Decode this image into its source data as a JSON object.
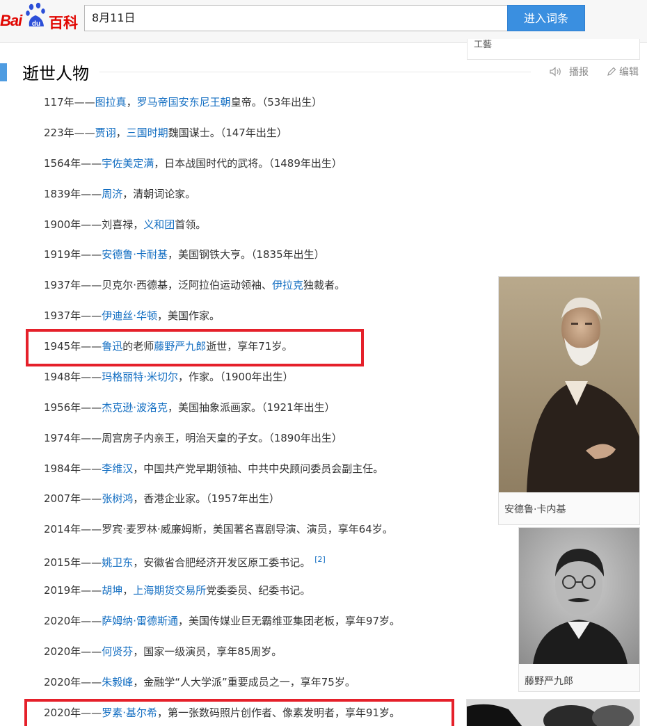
{
  "header": {
    "logo_bai": "Bai",
    "logo_du": "du",
    "logo_baike": "百科",
    "search_value": "8月11日",
    "search_button": "进入词条",
    "cut_text": "工藝"
  },
  "section": {
    "title": "逝世人物",
    "broadcast_label": "播报",
    "edit_label": "编辑"
  },
  "rows": [
    {
      "date": "117年——",
      "parts": [
        [
          "l",
          "图拉真"
        ],
        [
          "t",
          "，"
        ],
        [
          "l",
          "罗马帝国安东尼王朝"
        ],
        [
          "t",
          "皇帝。（53年出生）"
        ]
      ]
    },
    {
      "date": "223年——",
      "parts": [
        [
          "l",
          "贾诩"
        ],
        [
          "t",
          "，"
        ],
        [
          "l",
          "三国时期"
        ],
        [
          "t",
          "魏国谋士。（147年出生）"
        ]
      ]
    },
    {
      "date": "1564年——",
      "parts": [
        [
          "l",
          "宇佐美定满"
        ],
        [
          "t",
          "，日本战国时代的武将。（1489年出生）"
        ]
      ]
    },
    {
      "date": "1839年——",
      "parts": [
        [
          "l",
          "周济"
        ],
        [
          "t",
          "，清朝词论家。"
        ]
      ]
    },
    {
      "date": "1900年——",
      "parts": [
        [
          "t",
          "刘喜禄，"
        ],
        [
          "l",
          "义和团"
        ],
        [
          "t",
          "首领。"
        ]
      ]
    },
    {
      "date": "1919年——",
      "parts": [
        [
          "l",
          "安德鲁·卡耐基"
        ],
        [
          "t",
          "，美国钢铁大亨。（1835年出生）"
        ]
      ]
    },
    {
      "date": "1937年——",
      "parts": [
        [
          "t",
          "贝克尔·西德基，泛阿拉伯运动领袖、"
        ],
        [
          "l",
          "伊拉克"
        ],
        [
          "t",
          "独裁者。"
        ]
      ]
    },
    {
      "date": "1937年——",
      "parts": [
        [
          "l",
          "伊迪丝·华顿"
        ],
        [
          "t",
          "，美国作家。"
        ]
      ]
    },
    {
      "date": "1945年——",
      "parts": [
        [
          "l",
          "鲁迅"
        ],
        [
          "t",
          "的老师"
        ],
        [
          "l",
          "藤野严九郎"
        ],
        [
          "t",
          "逝世，享年71岁。"
        ]
      ]
    },
    {
      "date": "1948年——",
      "parts": [
        [
          "l",
          "玛格丽特·米切尔"
        ],
        [
          "t",
          "，作家。（1900年出生）"
        ]
      ]
    },
    {
      "date": "1956年——",
      "parts": [
        [
          "l",
          "杰克逊·波洛克"
        ],
        [
          "t",
          "，美国抽象派画家。（1921年出生）"
        ]
      ]
    },
    {
      "date": "1974年——",
      "parts": [
        [
          "t",
          "周宫房子内亲王，明治天皇的子女。（1890年出生）"
        ]
      ]
    },
    {
      "date": "1984年——",
      "parts": [
        [
          "l",
          "李维汉"
        ],
        [
          "t",
          "，中国共产党早期领袖、中共中央顾问委员会副主任。"
        ]
      ]
    },
    {
      "date": "2007年——",
      "parts": [
        [
          "l",
          "张树鸿"
        ],
        [
          "t",
          "，香港企业家。（1957年出生）"
        ]
      ]
    },
    {
      "date": "2014年——",
      "parts": [
        [
          "t",
          "罗宾·麦罗林·威廉姆斯，美国著名喜剧导演、演员，享年64岁。"
        ]
      ]
    },
    {
      "date": "2015年——",
      "parts": [
        [
          "l",
          "姚卫东"
        ],
        [
          "t",
          "，安徽省合肥经济开发区原工委书记。"
        ],
        [
          "s",
          "[2]"
        ]
      ]
    },
    {
      "date": "2019年——",
      "parts": [
        [
          "l",
          "胡坤"
        ],
        [
          "t",
          "，"
        ],
        [
          "l",
          "上海期货交易所"
        ],
        [
          "t",
          "党委委员、纪委书记。"
        ]
      ]
    },
    {
      "date": "2020年——",
      "parts": [
        [
          "l",
          "萨姆纳·雷德斯通"
        ],
        [
          "t",
          "，美国传媒业巨无霸维亚集团老板，享年97岁。"
        ]
      ]
    },
    {
      "date": "2020年——",
      "parts": [
        [
          "l",
          "何贤芬"
        ],
        [
          "t",
          "，国家一级演员，享年85周岁。"
        ]
      ]
    },
    {
      "date": "2020年——",
      "parts": [
        [
          "l",
          "朱毅峰"
        ],
        [
          "t",
          "，金融学“人大学派”重要成员之一，享年75岁。"
        ]
      ]
    },
    {
      "date": "2020年——",
      "parts": [
        [
          "l",
          "罗素·基尔希"
        ],
        [
          "t",
          "，第一张数码照片创作者、像素发明者，享年91岁。"
        ]
      ]
    }
  ],
  "pictures": [
    {
      "caption": "安德鲁·卡内基"
    },
    {
      "caption": "藤野严九郎"
    }
  ],
  "colors": {
    "link": "#136ec2",
    "highlight": "#e5202a",
    "accent": "#4f9ce1",
    "button": "#3a8fe0"
  }
}
